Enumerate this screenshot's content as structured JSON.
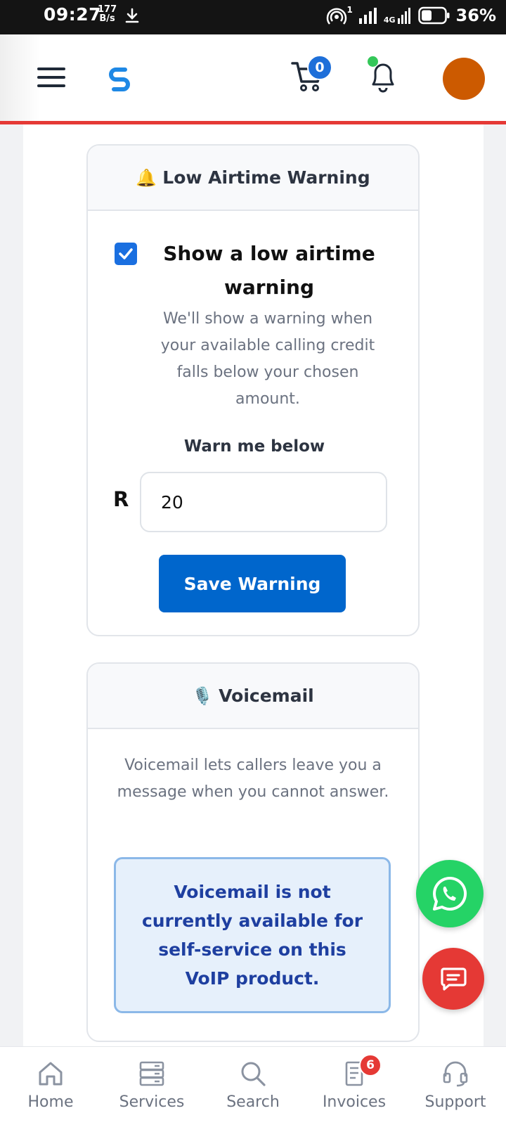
{
  "status_bar": {
    "time": "09:27",
    "net_speed_value": "177",
    "net_speed_unit": "B/s",
    "hotspot_sup": "1",
    "network_type": "4G",
    "battery_percent": "36%"
  },
  "header": {
    "cart_count": "0",
    "accent_color": "#e53935",
    "avatar_color": "#cc5a00",
    "logo_color": "#1e88e5"
  },
  "low_airtime": {
    "header_emoji": "🔔",
    "header_title": "Low Airtime Warning",
    "checkbox_checked": true,
    "option_title": "Show a low airtime warning",
    "option_description": "We'll show a warning when your available calling credit falls below your chosen amount.",
    "warn_label": "Warn me below",
    "currency_symbol": "R",
    "amount_value": "20",
    "save_button": "Save Warning"
  },
  "voicemail": {
    "header_emoji": "🎙️",
    "header_title": "Voicemail",
    "description": "Voicemail lets callers leave you a message when you cannot answer.",
    "notice": "Voicemail is not currently available for self-service on this VoIP product."
  },
  "fabs": {
    "whatsapp_icon": "whatsapp-icon",
    "chat_icon": "chat-icon"
  },
  "bottom_nav": {
    "items": [
      {
        "label": "Home",
        "icon": "home-icon"
      },
      {
        "label": "Services",
        "icon": "server-icon"
      },
      {
        "label": "Search",
        "icon": "search-icon"
      },
      {
        "label": "Invoices",
        "icon": "invoice-icon",
        "badge": "6"
      },
      {
        "label": "Support",
        "icon": "headset-icon"
      }
    ]
  }
}
